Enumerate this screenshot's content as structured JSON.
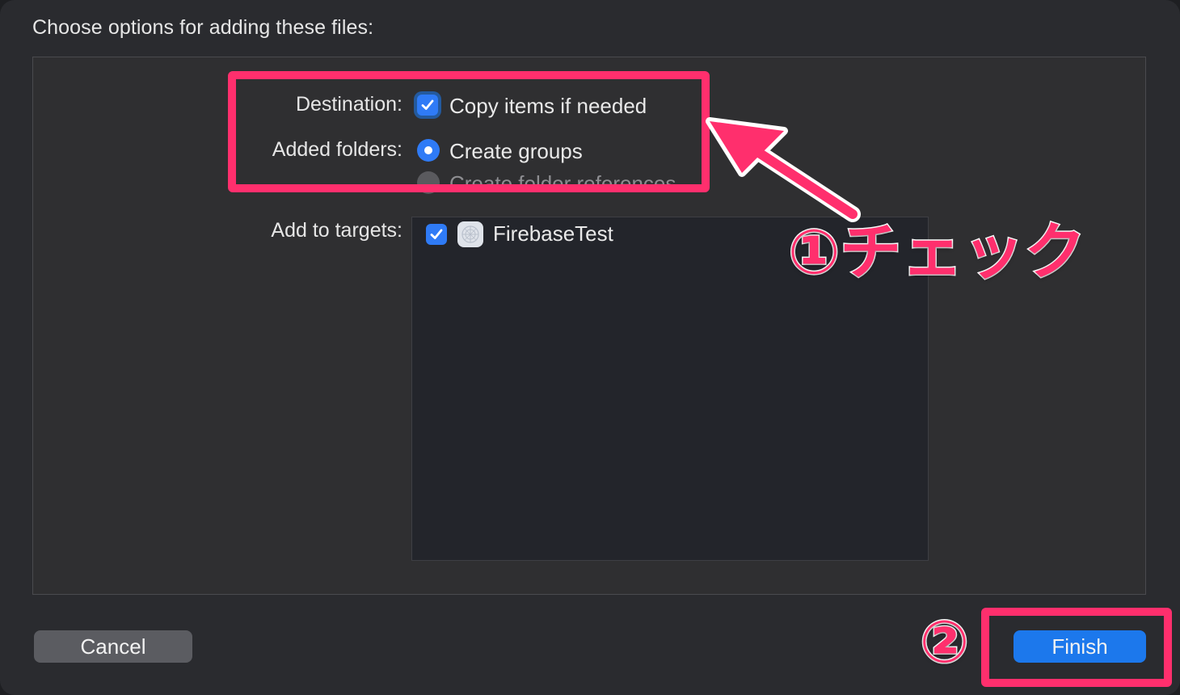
{
  "dialog": {
    "header": "Choose options for adding these files:"
  },
  "destination": {
    "label": "Destination:",
    "checkbox_label": "Copy items if needed",
    "checked": true
  },
  "added_folders": {
    "label": "Added folders:",
    "options": [
      {
        "label": "Create groups",
        "selected": true
      },
      {
        "label": "Create folder references",
        "selected": false
      }
    ]
  },
  "targets": {
    "label": "Add to targets:",
    "items": [
      {
        "name": "FirebaseTest",
        "checked": true,
        "icon": "app-target-icon"
      }
    ]
  },
  "buttons": {
    "cancel": "Cancel",
    "finish": "Finish"
  },
  "annotations": {
    "step1": "①チェック",
    "step2": "②",
    "color": "#ff2f6d"
  },
  "colors": {
    "accent": "#2f7bf6",
    "finish_button": "#1c78ec",
    "background": "#2a2b2f"
  }
}
